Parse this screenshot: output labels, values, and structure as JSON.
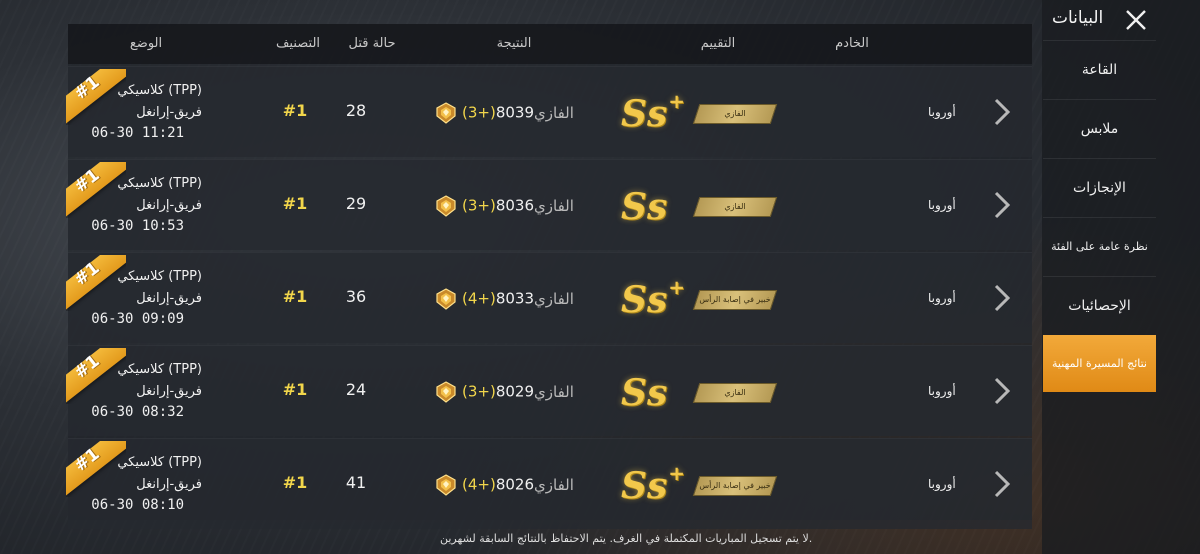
{
  "sidebar": {
    "title": "البيانات",
    "items": [
      {
        "label": "القاعة",
        "active": false
      },
      {
        "label": "ملابس",
        "active": false
      },
      {
        "label": "الإنجازات",
        "active": false
      },
      {
        "label": "نظرة عامة على الفئة",
        "active": false
      },
      {
        "label": "الإحصائيات",
        "active": false
      },
      {
        "label": "نتائج المسيرة المهنية",
        "active": true
      }
    ]
  },
  "table": {
    "headers": {
      "mode": "الوضع",
      "ranking": "التصنيف",
      "kills": "حالة قتل",
      "result": "النتيجة",
      "rating": "التقييم",
      "server": "الخادم"
    },
    "rows": [
      {
        "ribbon": "#1",
        "mode": "كلاسيكي (TPP)",
        "map": "فريق-إرانغل",
        "time": "06-30 11:21",
        "rank": "#1",
        "kills": "28",
        "delta": "(+3)",
        "points": "8039",
        "tier": "الفازي",
        "grade": "Ss",
        "grade_plus": "+",
        "badge": "الفازي",
        "server": "أوروبا"
      },
      {
        "ribbon": "#1",
        "mode": "كلاسيكي (TPP)",
        "map": "فريق-إرانغل",
        "time": "06-30 10:53",
        "rank": "#1",
        "kills": "29",
        "delta": "(+3)",
        "points": "8036",
        "tier": "الفازي",
        "grade": "Ss",
        "grade_plus": "",
        "badge": "الفازي",
        "server": "أوروبا"
      },
      {
        "ribbon": "#1",
        "mode": "كلاسيكي (TPP)",
        "map": "فريق-إرانغل",
        "time": "06-30 09:09",
        "rank": "#1",
        "kills": "36",
        "delta": "(+4)",
        "points": "8033",
        "tier": "الفازي",
        "grade": "Ss",
        "grade_plus": "+",
        "badge": "خبير في إصابة الرأس",
        "server": "أوروبا"
      },
      {
        "ribbon": "#1",
        "mode": "كلاسيكي (TPP)",
        "map": "فريق-إرانغل",
        "time": "06-30 08:32",
        "rank": "#1",
        "kills": "24",
        "delta": "(+3)",
        "points": "8029",
        "tier": "الفازي",
        "grade": "Ss",
        "grade_plus": "",
        "badge": "الفازي",
        "server": "أوروبا"
      },
      {
        "ribbon": "#1",
        "mode": "كلاسيكي (TPP)",
        "map": "فريق-إرانغل",
        "time": "06-30 08:10",
        "rank": "#1",
        "kills": "41",
        "delta": "(+4)",
        "points": "8026",
        "tier": "الفازي",
        "grade": "Ss",
        "grade_plus": "+",
        "badge": "خبير في إصابة الرأس",
        "server": "أوروبا"
      }
    ]
  },
  "footer": {
    "note": "لا يتم تسجيل المباريات المكتملة في الغرف. يتم الاحتفاظ بالنتائج السابقة لشهرين."
  },
  "colors": {
    "accent": "#f2d64b",
    "ribbon": "#f3b93a",
    "active_tab": "#e08a16"
  }
}
